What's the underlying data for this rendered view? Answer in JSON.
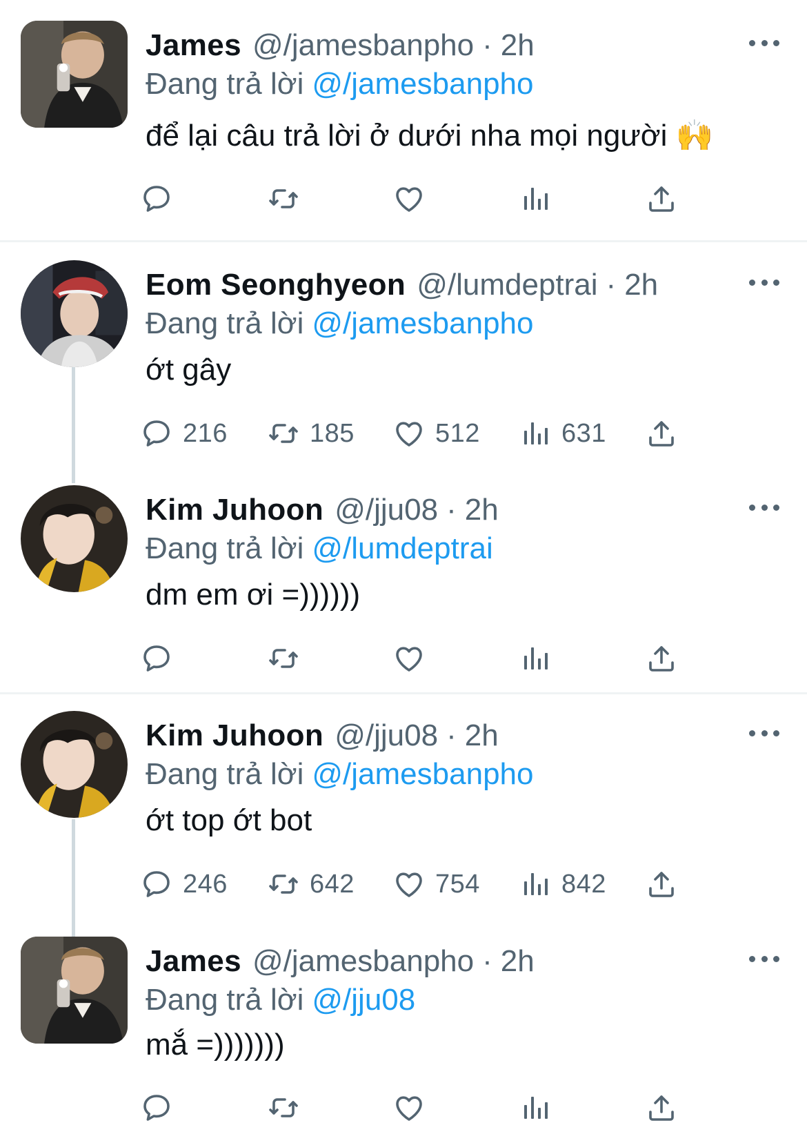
{
  "colors": {
    "link": "#1d9bf0",
    "muted": "#536471",
    "text": "#0f1419",
    "divider": "#eff3f4"
  },
  "icons": [
    "reply-icon",
    "retweet-icon",
    "like-icon",
    "views-icon",
    "share-icon",
    "more-icon"
  ],
  "tweets": [
    {
      "name": "James",
      "handle": "@/jamesbanpho",
      "dot": "·",
      "time": "2h",
      "reply_prefix": "Đang trả lời",
      "reply_to": "@/jamesbanpho",
      "text": "để lại câu trả lời ở dưới nha mọi người 🙌",
      "counts": {
        "replies": "",
        "retweets": "",
        "likes": "",
        "views": ""
      }
    },
    {
      "name": "Eom Seonghyeon",
      "handle": "@/lumdeptrai",
      "dot": "·",
      "time": "2h",
      "reply_prefix": "Đang trả lời",
      "reply_to": "@/jamesbanpho",
      "text": "ớt gây",
      "counts": {
        "replies": "216",
        "retweets": "185",
        "likes": "512",
        "views": "631"
      }
    },
    {
      "name": "Kim Juhoon",
      "handle": "@/jju08",
      "dot": "·",
      "time": "2h",
      "reply_prefix": "Đang trả lời",
      "reply_to": "@/lumdeptrai",
      "text": "dm em ơi =))))))",
      "counts": {
        "replies": "",
        "retweets": "",
        "likes": "",
        "views": ""
      }
    },
    {
      "name": "Kim Juhoon",
      "handle": "@/jju08",
      "dot": "·",
      "time": "2h",
      "reply_prefix": "Đang trả lời",
      "reply_to": "@/jamesbanpho",
      "text": "ớt top ớt bot",
      "counts": {
        "replies": "246",
        "retweets": "642",
        "likes": "754",
        "views": "842"
      }
    },
    {
      "name": "James",
      "handle": "@/jamesbanpho",
      "dot": "·",
      "time": "2h",
      "reply_prefix": "Đang trả lời",
      "reply_to": "@/jju08",
      "text": "mắ =)))))))",
      "counts": {
        "replies": "",
        "retweets": "",
        "likes": "",
        "views": ""
      }
    }
  ]
}
